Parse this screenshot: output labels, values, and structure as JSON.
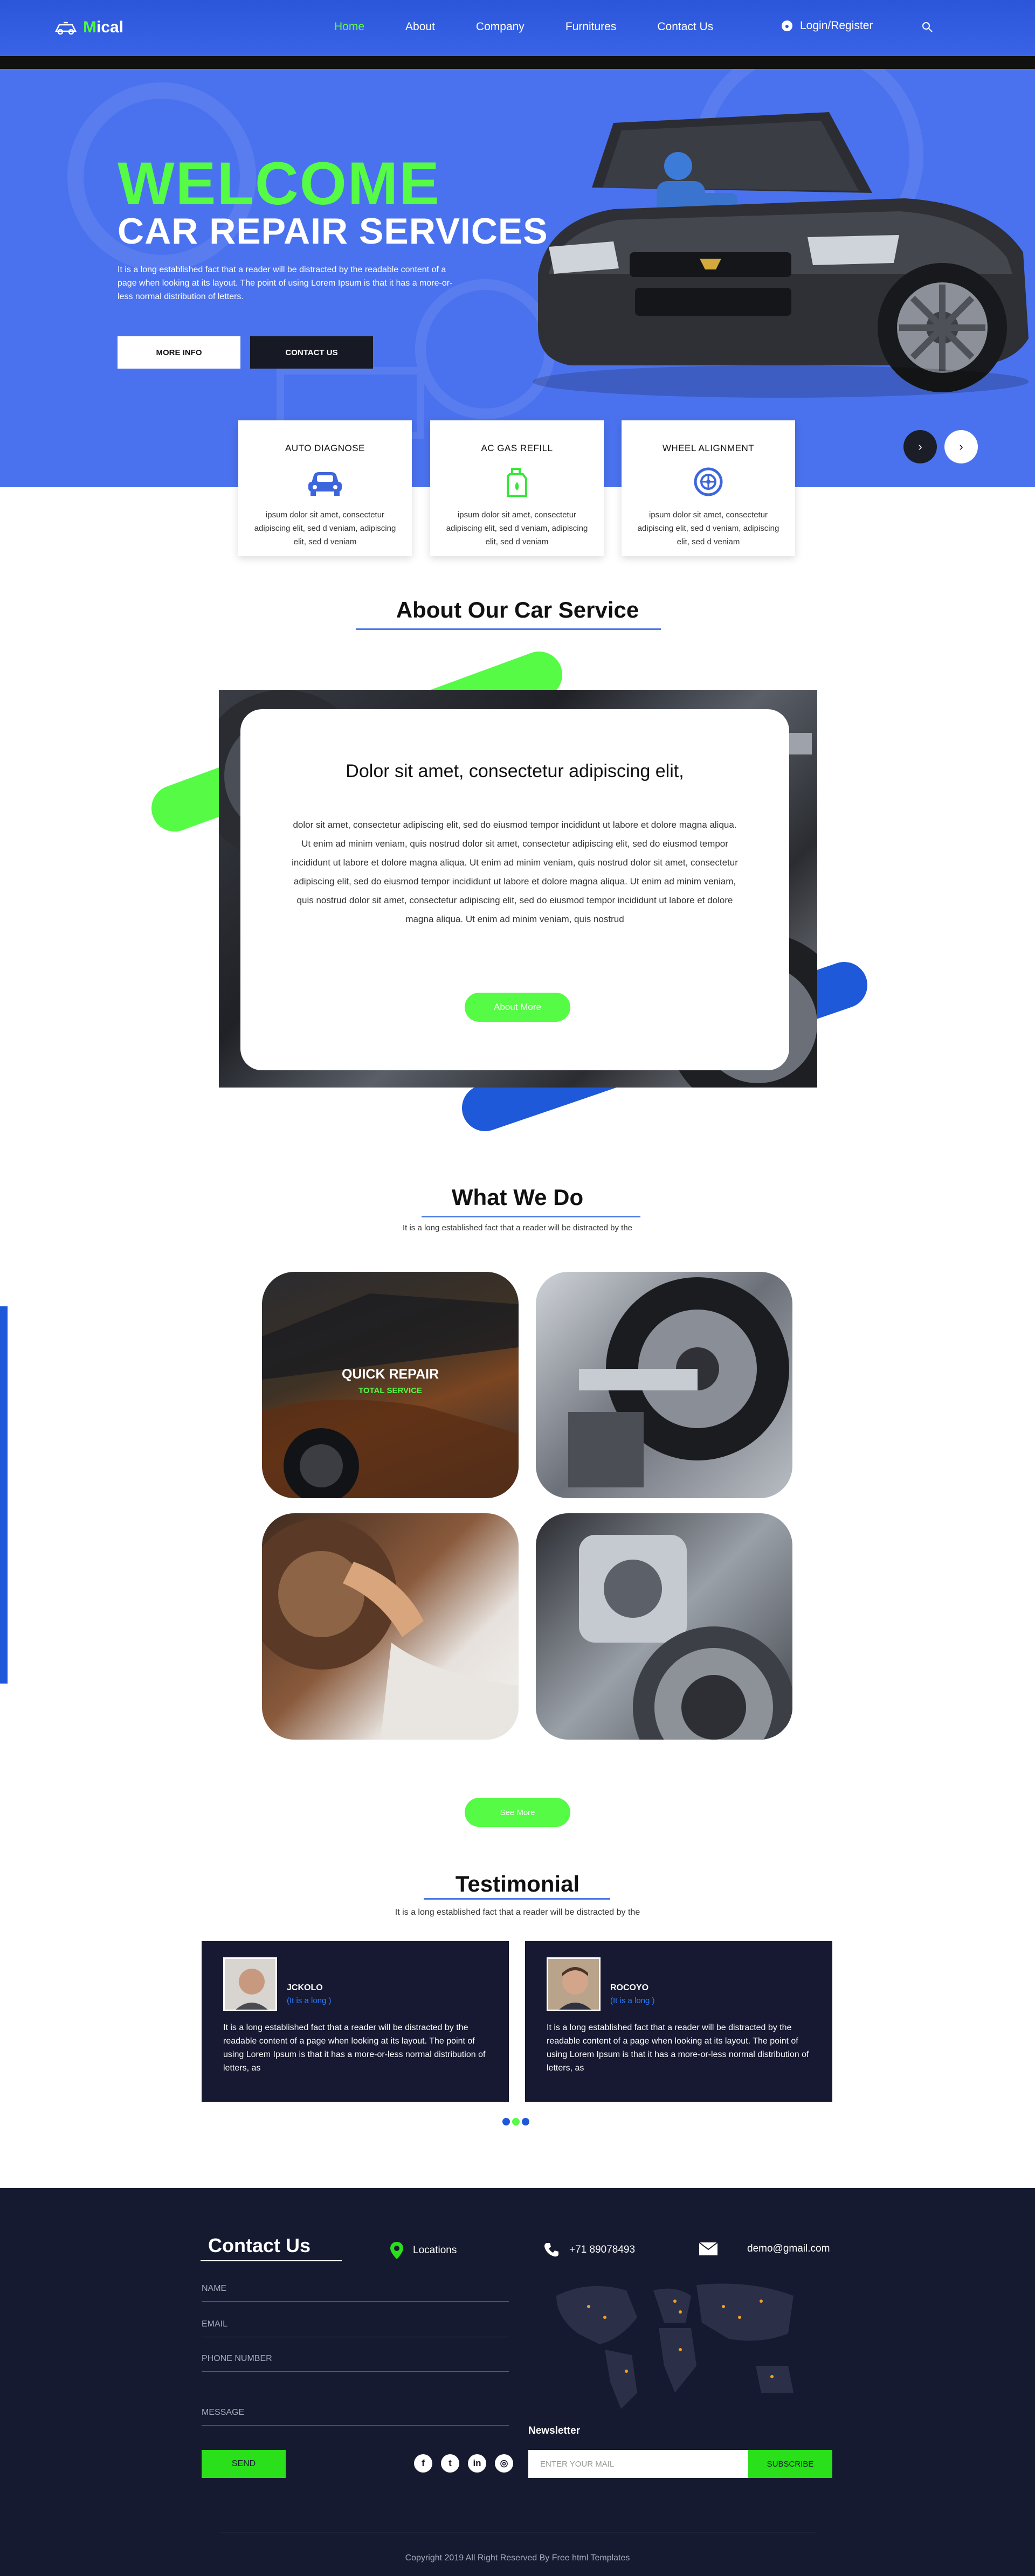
{
  "header": {
    "logo_brand_initial": "M",
    "logo_brand_rest": "ical",
    "nav": [
      "Home",
      "About",
      "Company",
      "Furnitures",
      "Contact Us"
    ],
    "active_nav": "Home",
    "login": "Login/Register"
  },
  "hero": {
    "welcome": "WELCOME",
    "subtitle": "CAR REPAIR SERVICES",
    "text": "It is a long established fact that a reader will be distracted by the readable content of a page when looking at its layout. The point of using Lorem Ipsum is that it has a more-or-less normal distribution of letters.",
    "btn_more": "MORE INFO",
    "btn_contact": "CONTACT US"
  },
  "features": [
    {
      "title": "AUTO DIAGNOSE",
      "icon": "car-icon",
      "text": "ipsum dolor sit amet, consectetur adipiscing elit, sed d veniam, adipiscing elit, sed d veniam"
    },
    {
      "title": "AC GAS REFILL",
      "icon": "gas-can-icon",
      "text": "ipsum dolor sit amet, consectetur adipiscing elit, sed d veniam, adipiscing elit, sed d veniam"
    },
    {
      "title": "WHEEL ALIGNMENT",
      "icon": "wheel-icon",
      "text": "ipsum dolor sit amet, consectetur adipiscing elit, sed d veniam, adipiscing elit, sed d veniam"
    }
  ],
  "about": {
    "title": "About Our Car Service",
    "heading": "Dolor sit amet, consectetur adipiscing elit,",
    "text": "dolor sit amet, consectetur adipiscing elit, sed do eiusmod tempor incididunt ut labore et dolore magna aliqua. Ut enim ad minim veniam, quis nostrud dolor sit amet, consectetur adipiscing elit, sed do eiusmod tempor incididunt ut labore et dolore magna aliqua. Ut enim ad minim veniam, quis nostrud dolor sit amet, consectetur adipiscing elit, sed do eiusmod tempor incididunt ut labore et dolore magna aliqua. Ut enim ad minim veniam, quis nostrud dolor sit amet, consectetur adipiscing elit, sed do eiusmod tempor incididunt ut labore et dolore magna aliqua. Ut enim ad minim veniam, quis nostrud",
    "button": "About More"
  },
  "whatwedo": {
    "title": "What We Do",
    "subtitle": "It is a long established fact that a reader will be distracted by the",
    "tile_title": "QUICK REPAIR",
    "tile_subtitle": "TOTAL SERVICE",
    "button": "See More"
  },
  "testimonial": {
    "title": "Testimonial",
    "subtitle": "It is a long established fact that a reader will be distracted by the",
    "items": [
      {
        "name": "JCKOLO",
        "role": "(It is a long )",
        "text": "It is a long established fact that a reader will be distracted by the readable content of a page when looking at its layout. The point of using Lorem Ipsum is that it has a more-or-less normal distribution of letters, as"
      },
      {
        "name": "ROCOYO",
        "role": "(It is a long )",
        "text": "It is a long established fact that a reader will be distracted by the readable content of a page when looking at its layout. The point of using Lorem Ipsum is that it has a more-or-less normal distribution of letters, as"
      }
    ]
  },
  "footer": {
    "contact_title": "Contact Us",
    "location": "Locations",
    "phone": "+71 89078493",
    "email": "demo@gmail.com",
    "fields": [
      "NAME",
      "EMAIL",
      "PHONE NUMBER",
      "MESSAGE"
    ],
    "send": "SEND",
    "social_icons": [
      "facebook-icon",
      "twitter-icon",
      "linkedin-icon",
      "instagram-icon"
    ],
    "newsletter": "Newsletter",
    "newsletter_placeholder": "ENTER YOUR MAIL",
    "subscribe": "SUBSCRIBE",
    "copyright": "Copyright 2019 All Right Reserved By Free  html Templates"
  },
  "colors": {
    "primary_blue": "#4b72ee",
    "accent_green": "#55fb44",
    "dark_navy": "#161a30"
  }
}
